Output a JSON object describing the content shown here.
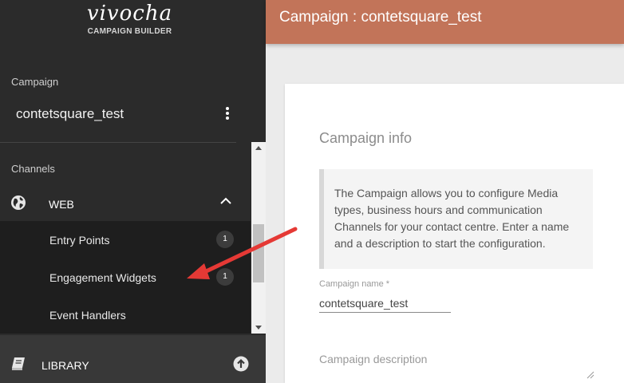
{
  "brand": {
    "logo_text": "vivocha",
    "subtitle": "CAMPAIGN BUILDER"
  },
  "sidebar": {
    "campaign_label": "Campaign",
    "campaign_name": "contetsquare_test",
    "channels_label": "Channels",
    "web": {
      "label": "WEB",
      "icon": "globe-icon",
      "expanded": true,
      "items": [
        {
          "label": "Entry Points",
          "count": "1"
        },
        {
          "label": "Engagement Widgets",
          "count": "1"
        },
        {
          "label": "Event Handlers"
        }
      ]
    },
    "library": {
      "label": "LIBRARY",
      "icon": "book-icon"
    }
  },
  "header": {
    "title": "Campaign : contetsquare_test"
  },
  "card": {
    "title": "Campaign info",
    "info": "The Campaign allows you to configure Media types, business hours and communication Channels for your contact centre. Enter a name and a description to start the configuration.",
    "name_label": "Campaign name *",
    "name_value": "contetsquare_test",
    "description_label": "Campaign description"
  },
  "colors": {
    "header": "#c27459",
    "sidebar": "#2b2b2b",
    "arrow": "#e53935"
  }
}
